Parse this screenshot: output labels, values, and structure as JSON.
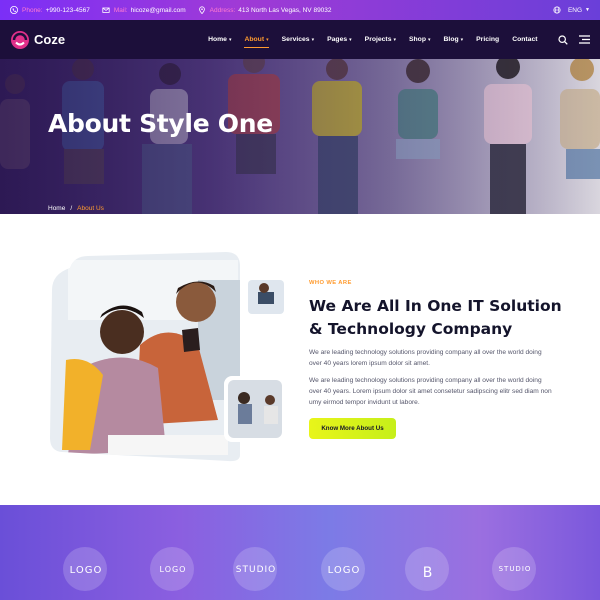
{
  "topbar": {
    "phone_key": "Phone:",
    "phone": "+990-123-4567",
    "mail_key": "Mail:",
    "mail": "hicoze@gmail.com",
    "address_key": "Address:",
    "address": "413 North Las Vegas, NV 89032",
    "language": "ENG"
  },
  "nav": {
    "brand": "Coze",
    "items": [
      {
        "label": "Home",
        "dropdown": true
      },
      {
        "label": "About",
        "dropdown": true,
        "active": true
      },
      {
        "label": "Services",
        "dropdown": true
      },
      {
        "label": "Pages",
        "dropdown": true
      },
      {
        "label": "Projects",
        "dropdown": true
      },
      {
        "label": "Shop",
        "dropdown": true
      },
      {
        "label": "Blog",
        "dropdown": true
      },
      {
        "label": "Pricing",
        "dropdown": false
      },
      {
        "label": "Contact",
        "dropdown": false
      }
    ]
  },
  "hero": {
    "title": "About Style One",
    "breadcrumb": [
      "Home",
      "/",
      "About Us"
    ]
  },
  "about": {
    "eyebrow": "WHO WE ARE",
    "title": "We Are All In One IT Solution & Technology Company",
    "para1": "We are leading technology solutions providing company all over the world doing over 40 years lorem ipsum dolor sit amet.",
    "para2": "We are leading technology solutions providing company all over the world doing over 40 years. Lorem ipsum dolor sit amet consetetur sadipscing elitr sed diam non umy eirmod tempor invidunt ut labore.",
    "button": "Know More About Us"
  },
  "logos": [
    "LOGO",
    "LOGO",
    "STUDIO",
    "LOGO",
    "B",
    "STUDIO"
  ],
  "colors": {
    "accent": "#ff9b2f",
    "nav_bg": "#1c0f3a",
    "button": "#e8f51a",
    "topbar_key": "#ff7ad1"
  }
}
